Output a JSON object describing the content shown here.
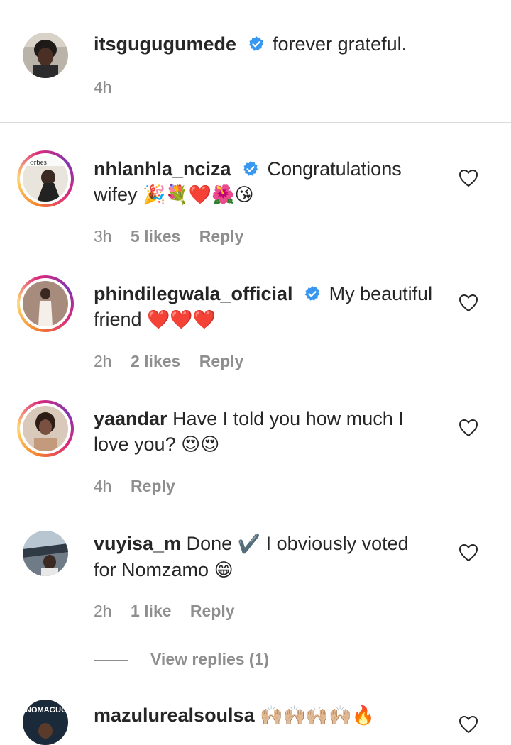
{
  "caption": {
    "username": "itsgugugumede",
    "text": "forever grateful.",
    "time": "4h"
  },
  "comments": [
    {
      "username": "nhlanhla_nciza",
      "verified": true,
      "text": "Congratulations wifey",
      "emojis": "🎉💐❤️🌺😘",
      "time": "3h",
      "likes": "5 likes",
      "reply": "Reply"
    },
    {
      "username": "phindilegwala_official",
      "verified": true,
      "text": "My beautiful friend",
      "emojis": "❤️❤️❤️",
      "time": "2h",
      "likes": "2 likes",
      "reply": "Reply"
    },
    {
      "username": "yaandar",
      "verified": false,
      "text": "Have I told you how much I love you?",
      "emojis": "😍😍",
      "time": "4h",
      "reply": "Reply"
    },
    {
      "username": "vuyisa_m",
      "verified": false,
      "text_part1": "Done",
      "check_emoji": "✔️",
      "text_part2": "I obviously voted for Nomzamo",
      "emojis": "😁",
      "time": "2h",
      "likes": "1 like",
      "reply": "Reply",
      "view_replies": "View replies (1)"
    },
    {
      "username": "mazulurealsoulsa",
      "verified": false,
      "emojis": "🙌🏼🙌🏼🙌🏼🙌🏼🔥",
      "avatar_text": "NOMAGUGU"
    }
  ],
  "colors": {
    "text": "#262626",
    "secondary": "#8e8e8e",
    "verified_blue": "#3897f0",
    "divider": "#dbdbdb"
  }
}
